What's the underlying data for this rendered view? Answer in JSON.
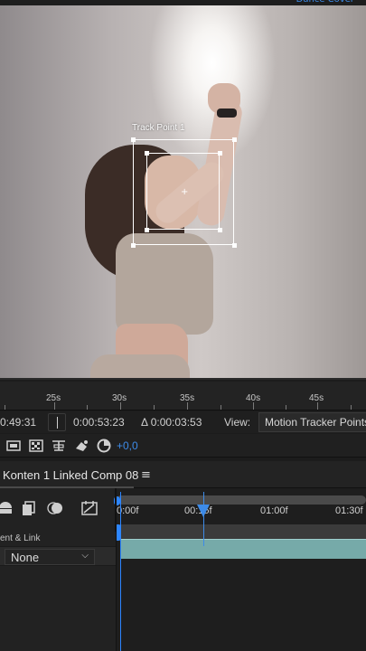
{
  "viewer": {
    "comp_tab": "• Dance Cover •",
    "track_point_label": "Track Point 1"
  },
  "ruler": {
    "ticks": [
      "25s",
      "30s",
      "35s",
      "40s",
      "45s"
    ]
  },
  "timecodes": {
    "current": "0:49:31",
    "out": "0:00:53:23",
    "duration": "Δ 0:00:03:53",
    "view_label": "View:",
    "view_value": "Motion Tracker Points"
  },
  "toolbar": {
    "exposure": "+0,0",
    "icons": [
      "region-of-interest-icon",
      "transparency-grid-icon",
      "fit-icon",
      "snapshot-icon",
      "color-manage-icon"
    ]
  },
  "composition": {
    "title": "Konten 1 Linked Comp 08",
    "menu_icon": "hamburger-menu-icon",
    "tools": [
      "solo-icon",
      "draft-3d-icon",
      "motion-blur-icon",
      "graph-editor-icon"
    ],
    "timeline_ticks": [
      "0:00f",
      "00:15f",
      "01:00f",
      "01:30f"
    ],
    "parent_column_label": "ent & Link",
    "parent_value": "None"
  },
  "colors": {
    "accent_blue": "#3d8be8",
    "layer_bar": "#76aaa9",
    "panel_bg": "#1e1e1e"
  }
}
